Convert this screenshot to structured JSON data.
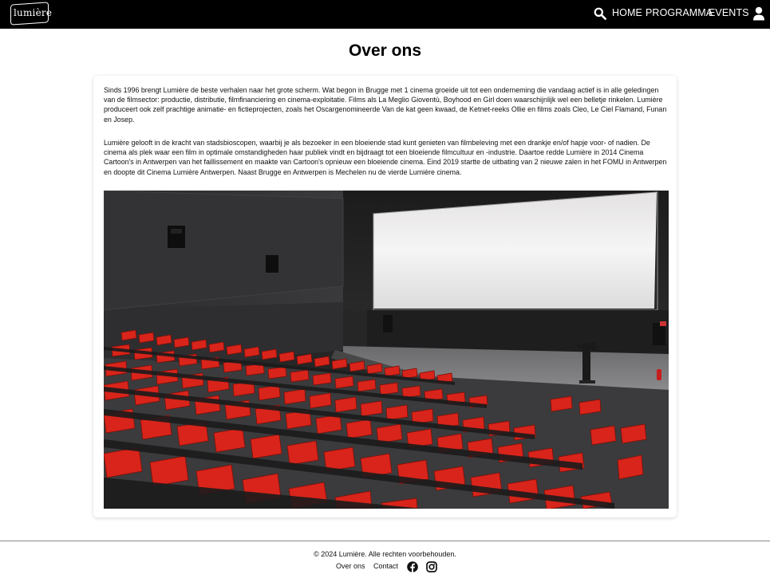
{
  "header": {
    "logo_text": "lumière",
    "nav": {
      "home": "HOME",
      "programma": "PROGRAMMA",
      "events": "EVENTS"
    },
    "icons": {
      "search": "search-icon",
      "user": "user-icon"
    }
  },
  "main": {
    "title": "Over ons",
    "paragraphs": [
      "Sinds 1996 brengt Lumière de beste verhalen naar het grote scherm. Wat begon in Brugge met 1 cinema groeide uit tot een onderneming die vandaag actief is in alle geledingen van de filmsector: productie, distributie, filmfinanciering en cinema-exploitatie. Films als La Meglio Gioventù, Boyhood en Girl doen waarschijnlijk wel een belletje rinkelen. Lumière produceert ook zelf prachtige animatie- en fictieprojecten, zoals het Oscargenomineerde Van de kat geen kwaad, de Ketnet-reeks Ollie en films zoals Cleo, Le Ciel Flamand, Funan en Josep.",
      "Lumière gelooft in de kracht van stadsbioscopen, waarbij je als bezoeker in een bloeiende stad kunt genieten van filmbeleving met een drankje en/of hapje voor- of nadien. De cinema als plek waar een film in optimale omstandigheden haar publiek vindt en bijdraagt tot een bloeiende filmcultuur en -industrie. Daartoe redde Lumière in 2014 Cinema Cartoon's in Antwerpen van het faillissement en maakte van Cartoon's opnieuw een bloeiende cinema. Eind 2019 startte de uitbating van 2 nieuwe zalen in het FOMU in Antwerpen en doopte dit Cinema Lumière Antwerpen. Naast Brugge en Antwerpen is Mechelen nu de vierde Lumière cinema."
    ]
  },
  "footer": {
    "copyright": "© 2024 Lumière. Alle rechten voorbehouden.",
    "links": {
      "about": "Over ons",
      "contact": "Contact"
    },
    "icons": {
      "facebook": "facebook-icon",
      "instagram": "instagram-icon"
    }
  },
  "colors": {
    "header_bg": "#000000",
    "seat_red": "#d8241a",
    "text": "#111111"
  }
}
